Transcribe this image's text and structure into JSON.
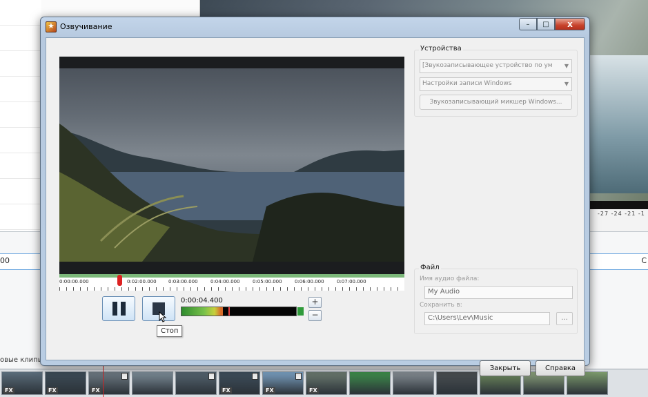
{
  "background": {
    "timeline_value": "00",
    "timeline_right": "C",
    "clips_label": "овые клипы",
    "meter_scale": "-27 -24 -21 -1",
    "filmstrip": [
      {
        "color": "#5a6c7a",
        "fx": true,
        "doc": false
      },
      {
        "color": "#3d4c58",
        "fx": true,
        "doc": false
      },
      {
        "color": "#6f7b84",
        "fx": true,
        "doc": true
      },
      {
        "color": "#7d8d98",
        "fx": false,
        "doc": false
      },
      {
        "color": "#556470",
        "fx": false,
        "doc": true
      },
      {
        "color": "#3e4e5c",
        "fx": true,
        "doc": true
      },
      {
        "color": "#7aa0c2",
        "fx": true,
        "doc": true
      },
      {
        "color": "#6c7a70",
        "fx": true,
        "doc": false
      },
      {
        "color": "#3e8f4b",
        "fx": false,
        "doc": false
      },
      {
        "color": "#858d94",
        "fx": false,
        "doc": false
      },
      {
        "color": "#4b4f52",
        "fx": false,
        "doc": false
      },
      {
        "color": "#6e8a5c",
        "fx": false,
        "doc": false
      },
      {
        "color": "#8aa07a",
        "fx": false,
        "doc": false
      },
      {
        "color": "#7c9a6c",
        "fx": false,
        "doc": false
      }
    ]
  },
  "dialog": {
    "title": "Озвучивание",
    "window_buttons": {
      "minimize": "–",
      "maximize": "□",
      "close": "x"
    },
    "ruler_ticks": [
      "0:00:00.000",
      "0:02:00.000",
      "0:03:00.000",
      "0:04:00.000",
      "0:05:00.000",
      "0:06:00.000",
      "0:07:00.000"
    ],
    "timecode": "0:00:04.400",
    "level": 0.36,
    "level_peak": 0.41,
    "tooltip": "Стоп",
    "plus": "+",
    "minus": "−",
    "devices": {
      "legend": "Устройства",
      "recording_device": "[Звукозаписывающее устройство по ум",
      "settings_combo": "Настройки записи Windows",
      "mixer_button": "Звукозаписывающий микшер Windows..."
    },
    "file": {
      "legend": "Файл",
      "name_label": "Имя аудио файла:",
      "name_value": "My Audio",
      "save_label": "Сохранить в:",
      "save_value": "C:\\Users\\Lev\\Music",
      "browse": "..."
    },
    "buttons": {
      "close": "Закрыть",
      "help": "Справка"
    }
  }
}
